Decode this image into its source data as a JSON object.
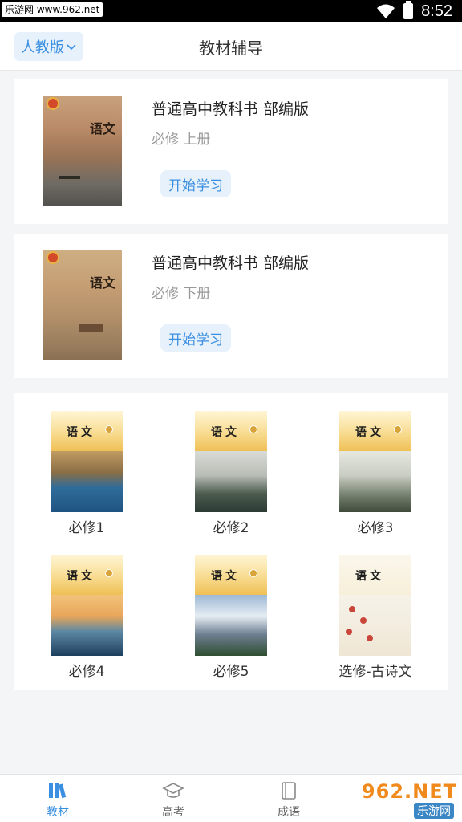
{
  "status_bar": {
    "watermark": "乐游网 www.962.net",
    "time": "8:52"
  },
  "header": {
    "edition": "人教版",
    "title": "教材辅导"
  },
  "books": [
    {
      "name": "普通高中教科书 部编版",
      "volume": "必修 上册",
      "cover_title": "语文",
      "action": "开始学习"
    },
    {
      "name": "普通高中教科书 部编版",
      "volume": "必修 下册",
      "cover_title": "语文",
      "action": "开始学习"
    }
  ],
  "grid": [
    {
      "label": "必修1",
      "cover_title": "语文"
    },
    {
      "label": "必修2",
      "cover_title": "语文"
    },
    {
      "label": "必修3",
      "cover_title": "语文"
    },
    {
      "label": "必修4",
      "cover_title": "语文"
    },
    {
      "label": "必修5",
      "cover_title": "语文"
    },
    {
      "label": "选修-古诗文",
      "cover_title": "语文"
    }
  ],
  "nav": [
    {
      "label": "教材",
      "icon": "books-icon",
      "active": true
    },
    {
      "label": "高考",
      "icon": "graduation-cap-icon",
      "active": false
    },
    {
      "label": "成语",
      "icon": "book-icon",
      "active": false
    }
  ],
  "brand": {
    "logo": "962.NET",
    "sub": "乐游网"
  },
  "colors": {
    "accent": "#3b8fe0",
    "accent_bg": "#e7f1fb",
    "background": "#f4f5f6"
  }
}
